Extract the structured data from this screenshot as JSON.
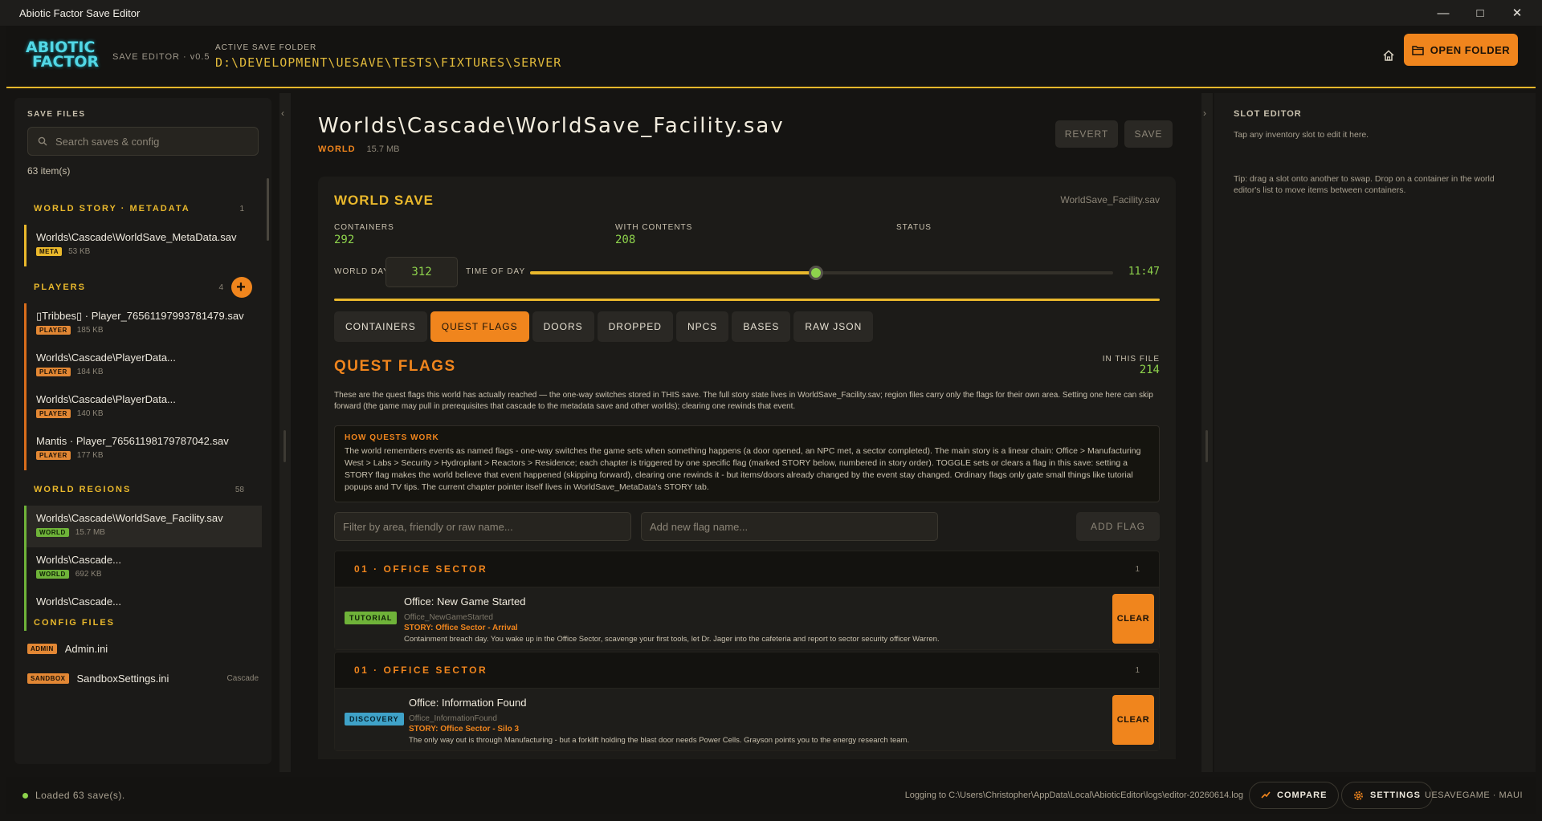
{
  "window": {
    "title": "Abiotic Factor Save Editor"
  },
  "header": {
    "logo_line1": "ABIOTIC",
    "logo_line2": "FACTOR",
    "editor_version": "SAVE EDITOR · v0.5",
    "active_folder_label": "ACTIVE SAVE FOLDER",
    "active_folder_path": "D:\\DEVELOPMENT\\UESAVE\\TESTS\\FIXTURES\\SERVER",
    "open_folder_label": "OPEN FOLDER"
  },
  "sidebar": {
    "title": "SAVE FILES",
    "search_placeholder": "Search saves & config",
    "item_count": "63 item(s)",
    "sections": {
      "story": {
        "label": "WORLD STORY · METADATA",
        "count": "1"
      },
      "players": {
        "label": "PLAYERS",
        "count": "4",
        "add": "+"
      },
      "regions": {
        "label": "WORLD REGIONS",
        "count": "58"
      }
    },
    "story_items": [
      {
        "name": "Worlds\\Cascade\\WorldSave_MetaData.sav",
        "badge": "META",
        "size": "53 KB"
      }
    ],
    "player_items": [
      {
        "name": "▯Tribbes▯ · Player_76561197993781479.sav",
        "badge": "PLAYER",
        "size": "185 KB"
      },
      {
        "name": "Worlds\\Cascade\\PlayerData...",
        "badge": "PLAYER",
        "size": "184 KB"
      },
      {
        "name": "Worlds\\Cascade\\PlayerData...",
        "badge": "PLAYER",
        "size": "140 KB"
      },
      {
        "name": "Mantis · Player_76561198179787042.sav",
        "badge": "PLAYER",
        "size": "177 KB"
      }
    ],
    "region_items": [
      {
        "name": "Worlds\\Cascade\\WorldSave_Facility.sav",
        "badge": "WORLD",
        "size": "15.7 MB"
      },
      {
        "name": "Worlds\\Cascade...",
        "badge": "WORLD",
        "size": "692 KB"
      },
      {
        "name": "Worlds\\Cascade..."
      }
    ],
    "config": {
      "label": "CONFIG FILES",
      "items": [
        {
          "badge": "ADMIN",
          "name": "Admin.ini",
          "right": ""
        },
        {
          "badge": "SANDBOX",
          "name": "SandboxSettings.ini",
          "right": "Cascade"
        }
      ]
    }
  },
  "main": {
    "file_title": "Worlds\\Cascade\\WorldSave_Facility.sav",
    "file_kind": "WORLD",
    "file_size": "15.7 MB",
    "revert_label": "REVERT",
    "save_label": "SAVE",
    "world_save": {
      "title": "WORLD SAVE",
      "filename": "WorldSave_Facility.sav",
      "containers_label": "CONTAINERS",
      "containers_value": "292",
      "with_contents_label": "WITH CONTENTS",
      "with_contents_value": "208",
      "status_label": "STATUS",
      "world_day_label": "WORLD DAY",
      "world_day_value": "312",
      "time_of_day_label": "TIME OF DAY",
      "time_of_day_value": "11:47",
      "time_of_day_fraction": 0.49
    },
    "tabs": [
      "CONTAINERS",
      "QUEST FLAGS",
      "DOORS",
      "DROPPED",
      "NPCS",
      "BASES",
      "RAW JSON"
    ],
    "active_tab": 1,
    "quest_flags": {
      "title": "QUEST FLAGS",
      "in_this_file_label": "IN THIS FILE",
      "in_this_file_value": "214",
      "description": "These are the quest flags this world has actually reached — the one-way switches stored in THIS save. The full story state lives in WorldSave_Facility.sav; region files carry only the flags for their own area. Setting one here can skip forward (the game may pull in prerequisites that cascade to the metadata save and other worlds); clearing one rewinds that event.",
      "how_title": "HOW QUESTS WORK",
      "how_text": "The world remembers events as named flags - one-way switches the game sets when something happens (a door opened, an NPC met, a sector completed). The main story is a linear chain: Office > Manufacturing West > Labs > Security > Hydroplant > Reactors > Residence; each chapter is triggered by one specific flag (marked STORY below, numbered in story order). TOGGLE sets or clears a flag in this save: setting a STORY flag makes the world believe that event happened (skipping forward), clearing one rewinds it - but items/doors already changed by the event stay changed. Ordinary flags only gate small things like tutorial popups and TV tips. The current chapter pointer itself lives in WorldSave_MetaData's STORY tab.",
      "filter_placeholder": "Filter by area, friendly or raw name...",
      "new_flag_placeholder": "Add new flag name...",
      "add_flag_label": "ADD FLAG",
      "groups": [
        {
          "title": "01 · OFFICE SECTOR",
          "count": "1",
          "flag": {
            "tag": "TUTORIAL",
            "name": "Office: New Game Started",
            "raw": "Office_NewGameStarted",
            "story": "STORY: Office Sector - Arrival",
            "desc": "Containment breach day. You wake up in the Office Sector, scavenge your first tools, let Dr. Jager into the cafeteria and report to sector security officer Warren.",
            "action": "CLEAR"
          }
        },
        {
          "title": "01 · OFFICE SECTOR",
          "count": "1",
          "flag": {
            "tag": "DISCOVERY",
            "name": "Office: Information Found",
            "raw": "Office_InformationFound",
            "story": "STORY: Office Sector - Silo 3",
            "desc": "The only way out is through Manufacturing - but a forklift holding the blast door needs Power Cells. Grayson points you to the energy research team.",
            "action": "CLEAR"
          }
        }
      ]
    }
  },
  "slot_editor": {
    "title": "SLOT EDITOR",
    "hint": "Tap any inventory slot to edit it here.",
    "tip": "Tip: drag a slot onto another to swap. Drop on a container in the world editor's list to move items between containers."
  },
  "footer": {
    "status": "Loaded 63 save(s).",
    "log_path": "Logging to C:\\Users\\Christopher\\AppData\\Local\\AbioticEditor\\logs\\editor-20260614.log",
    "compare_label": "COMPARE",
    "settings_label": "SETTINGS",
    "brand": "UESAVEGAME · MAUI"
  },
  "colors": {
    "accent_orange": "#f0851d",
    "accent_yellow": "#e9b82c",
    "value_green": "#8ed34c",
    "logo_cyan": "#52d8e6",
    "background": "#151412"
  }
}
